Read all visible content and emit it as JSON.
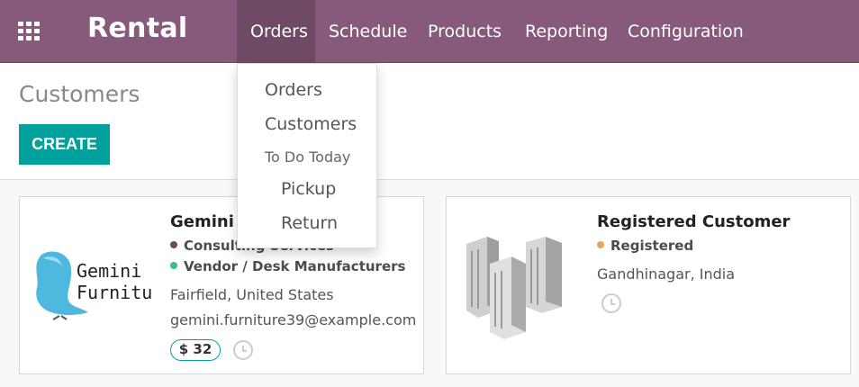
{
  "navbar": {
    "apps_icon": "grid-icon",
    "brand": "Rental",
    "menus": [
      "Orders",
      "Schedule",
      "Products",
      "Reporting",
      "Configuration"
    ],
    "active_menu": "Orders"
  },
  "page": {
    "title": "Customers",
    "create_label": "CREATE"
  },
  "dropdown": {
    "items": [
      "Orders",
      "Customers"
    ],
    "section_header": "To Do Today",
    "sub_items": [
      "Pickup",
      "Return"
    ]
  },
  "cards": [
    {
      "name": "Gemini F",
      "logo_text": [
        "Gemini",
        "Furniture"
      ],
      "tags": [
        {
          "label": "Consulting Services",
          "color": "#6e4a5f"
        },
        {
          "label": "Vendor / Desk Manufacturers",
          "color": "#3cbf86"
        }
      ],
      "location": "Fairfield, United States",
      "email": "gemini.furniture39@example.com",
      "badge": "$ 32"
    },
    {
      "name": "Registered Customer",
      "tags": [
        {
          "label": "Registered",
          "color": "#e9a35a"
        }
      ],
      "location": "Gandhinagar, India"
    }
  ],
  "colors": {
    "navbar": "#875a7b",
    "active": "#6e4a64",
    "primary": "#00a09d"
  }
}
